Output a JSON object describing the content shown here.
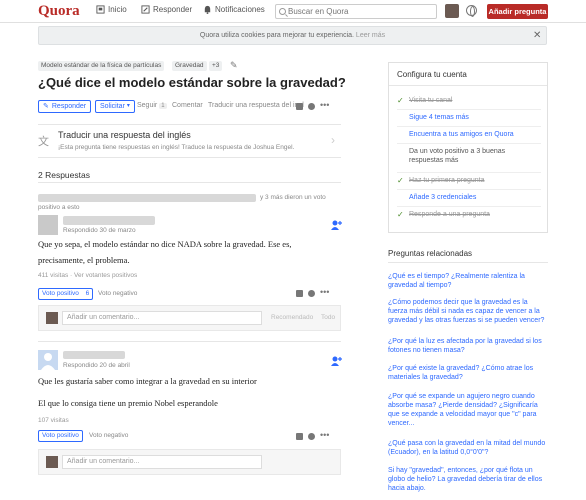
{
  "header": {
    "logo": "Quora",
    "nav": [
      "Inicio",
      "Responder",
      "Notificaciones"
    ],
    "search_placeholder": "Buscar en Quora",
    "add_question": "Añadir pregunta"
  },
  "cookie_bar": {
    "text": "Quora utiliza cookies para mejorar tu experiencia.",
    "link": "Leer más"
  },
  "question": {
    "topics": [
      "Modelo estándar de la física de partículas",
      "Gravedad",
      "+3"
    ],
    "title": "¿Qué dice el modelo estándar sobre la gravedad?",
    "actions": {
      "answer": "Responder",
      "request": "Solicitar",
      "follow": "Seguir",
      "follow_count": "1",
      "comment": "Comentar",
      "translate": "Traducir una respuesta del ingl"
    },
    "translate_box": {
      "title": "Traducir una respuesta del inglés",
      "subtitle": "¡Esta pregunta tiene respuestas en inglés! Traduce la respuesta de Joshua Engel."
    },
    "answers_count": "2 Respuestas"
  },
  "answers": [
    {
      "upvoters_suffix": "y 3 más dieron un voto",
      "upvoters_suffix2": "positivo a esto",
      "date": "Respondido 30 de marzo",
      "paragraphs": [
        "Que yo sepa, el modelo estándar no dice NADA sobre la gravedad. Ese es,",
        "precisamente, el problema."
      ],
      "stats": "411 visitas · Ver votantes positivos",
      "upvote": "Voto positivo",
      "upvote_count": "6",
      "downvote": "Voto negativo",
      "comment_placeholder": "Añadir un comentario...",
      "comment_recommended": "Recomendado",
      "comment_all": "Todo"
    },
    {
      "date": "Respondido 20 de abril",
      "paragraphs": [
        "Que les gustaría saber como integrar a la gravedad en su interior",
        "El que lo consiga tiene un premio Nobel esperandole"
      ],
      "stats": "107 visitas",
      "upvote": "Voto positivo",
      "downvote": "Voto negativo",
      "comment_placeholder": "Añadir un comentario..."
    }
  ],
  "sidebar": {
    "title": "Configura tu cuenta",
    "items": [
      {
        "label": "Visita tu canal",
        "state": "done"
      },
      {
        "label": "Sigue 4 temas más",
        "state": "link"
      },
      {
        "label": "Encuentra a tus amigos en Quora",
        "state": "link"
      },
      {
        "label": "Da un voto positivo a 3 buenas respuestas más",
        "state": "plain"
      },
      {
        "label": "Haz tu primera pregunta",
        "state": "done"
      },
      {
        "label": "Añade 3 credenciales",
        "state": "link"
      },
      {
        "label": "Responde a una pregunta",
        "state": "done"
      }
    ],
    "related_title": "Preguntas relacionadas",
    "related": [
      "¿Qué es el tiempo? ¿Realmente ralentiza la gravedad al tiempo?",
      "¿Cómo podemos decir que la gravedad es la fuerza más débil si nada es capaz de vencer a la gravedad y las otras fuerzas si se pueden vencer?",
      "¿Por qué la luz es afectada por la gravedad si los fotones no tienen masa?",
      "¿Por qué existe la gravedad? ¿Cómo atrae los materiales la gravedad?",
      "¿Por qué se expande un agujero negro cuando absorbe masa? ¿Pierde densidad? ¿Significaría que se expande a velocidad mayor que \"c\" para vencer...",
      "¿Qué pasa con la gravedad en la mitad del mundo (Ecuador), en la latitud 0,0°0'0\"?",
      "Si hay \"gravedad\", entonces, ¿por qué flota un globo de helio? La gravedad debería tirar de ellos hacia abajo."
    ]
  },
  "colors": {
    "brand": "#b92b27",
    "link": "#2e69ff",
    "check": "#4c8c2b"
  }
}
